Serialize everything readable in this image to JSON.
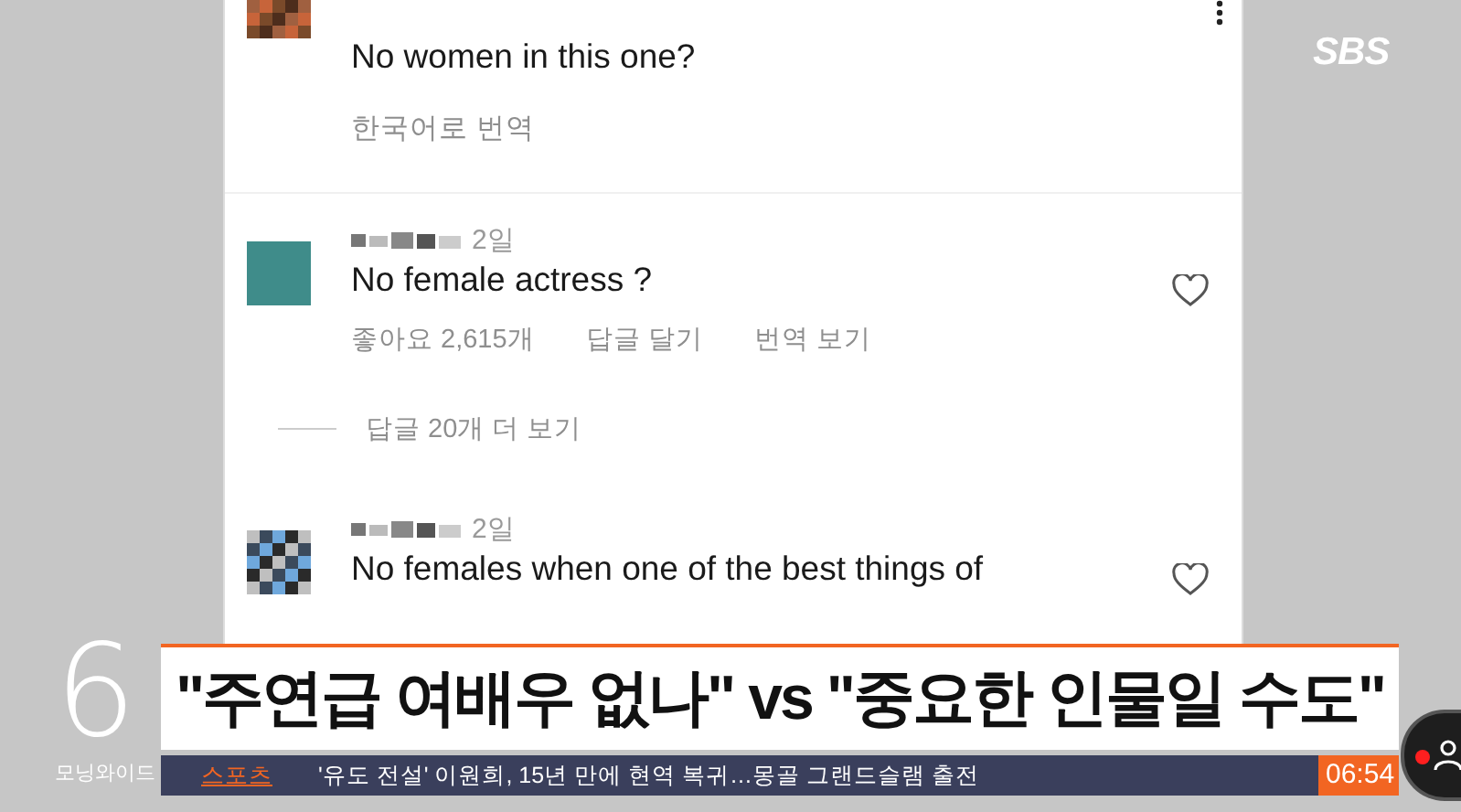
{
  "broadcaster": {
    "logo": "SBS"
  },
  "comments": [
    {
      "text": "No women in this one?",
      "translate": "한국어로 번역",
      "menu": true
    },
    {
      "time": "2일",
      "text": "No female actress ?",
      "likes": "좋아요 2,615개",
      "reply": "답글 달기",
      "translate": "번역 보기",
      "more_replies": "답글 20개 더 보기",
      "liked": false
    },
    {
      "time": "2일",
      "text": "No females when one of the best things of",
      "liked": false
    }
  ],
  "headline": "\"주연급 여배우 없나\" vs \"중요한 인물일 수도\"",
  "program": {
    "number": "6",
    "name": "모닝와이드"
  },
  "ticker": {
    "category": "스포츠",
    "text": "'유도 전설' 이원희, 15년 만에 현역 복귀…몽골 그랜드슬램 출전",
    "time": "06:54"
  }
}
